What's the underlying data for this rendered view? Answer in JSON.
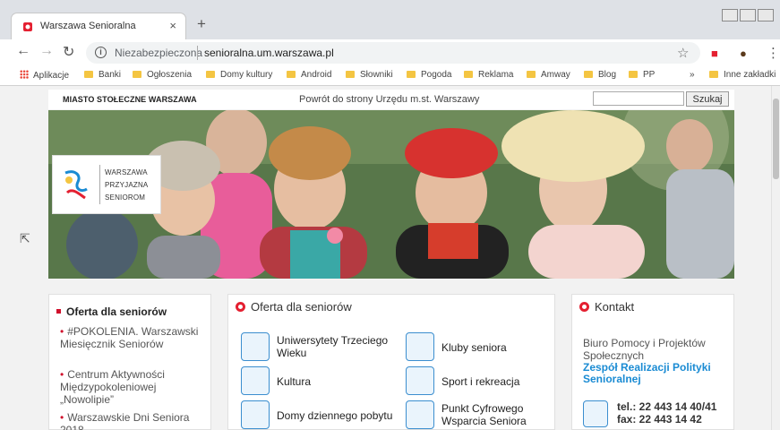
{
  "browser": {
    "tab_title": "Warszawa Senioralna",
    "tab_close": "×",
    "new_tab": "+",
    "security_label": "Niezabezpieczona",
    "url": "senioralna.um.warszawa.pl",
    "bookmarks": [
      "Aplikacje",
      "Banki",
      "Ogłoszenia",
      "Domy kultury",
      "Android",
      "Słowniki",
      "Pogoda",
      "Reklama",
      "Amway",
      "Blog",
      "PP"
    ],
    "overflow_label": "»",
    "other_bookmarks": "Inne zakładki"
  },
  "site": {
    "city_name": "MIASTO STOŁECZNE WARSZAWA",
    "back_link": "Powrót do strony Urzędu m.st. Warszawy",
    "search_button": "Szukaj",
    "brand_lines": [
      "WARSZAWA",
      "PRZYJAZNA",
      "SENIOROM"
    ],
    "colors": {
      "accent_red": "#e42031",
      "link_blue": "#1a8bd3"
    }
  },
  "sidebar": {
    "title": "Oferta dla seniorów",
    "items": [
      "#POKOLENIA. Warszawski Miesięcznik Seniorów",
      "Centrum Aktywności Międzypokoleniowej „Nowolipie”",
      "Warszawskie Dni Seniora 2018"
    ]
  },
  "offer": {
    "title": "Oferta dla seniorów",
    "items": [
      {
        "label": "Uniwersytety Trzeciego Wieku",
        "icon": "book-icon"
      },
      {
        "label": "Kluby seniora",
        "icon": "puzzle-icon"
      },
      {
        "label": "Kultura",
        "icon": "theater-icon"
      },
      {
        "label": "Sport i rekreacja",
        "icon": "dumbbell-icon"
      },
      {
        "label": "Domy dziennego pobytu",
        "icon": "calendar-icon"
      },
      {
        "label": "Punkt Cyfrowego Wsparcia Seniora",
        "icon": "clock-icon"
      }
    ]
  },
  "contact": {
    "title": "Kontakt",
    "office": "Biuro Pomocy i Projektów Społecznych",
    "team": "Zespół Realizacji Polityki Senioralnej",
    "tel": "tel.: 22 443 14 40/41",
    "fax": "fax: 22 443 14 42"
  }
}
